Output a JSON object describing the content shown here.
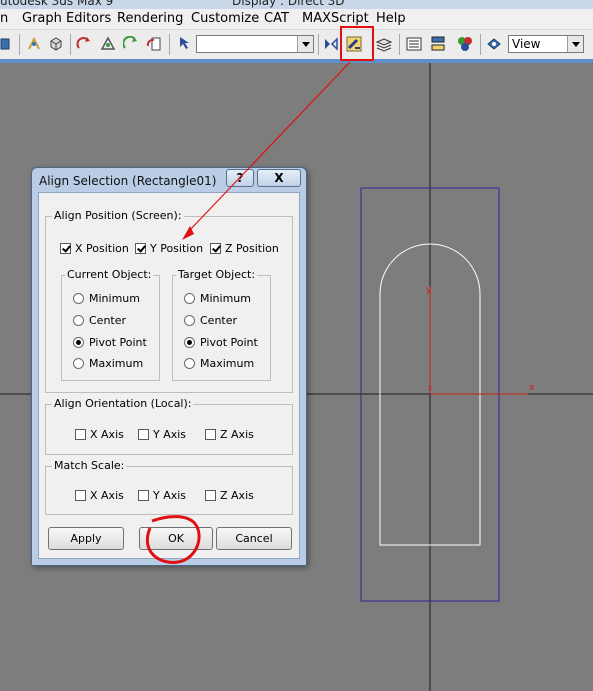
{
  "window": {
    "app_title": "utodesk 3ds Max 9",
    "display_title": "Display : Direct 3D"
  },
  "menu": {
    "items": [
      "n",
      "Graph Editors",
      "Rendering",
      "Customize",
      "CAT",
      "MAXScript",
      "Help"
    ]
  },
  "toolbar": {
    "selection_set_value": "",
    "view_dropdown_value": "View"
  },
  "dialog": {
    "title": "Align Selection (Rectangle01)",
    "help_button": "?",
    "close_button": "X",
    "align_position": {
      "legend": "Align Position (Screen):",
      "x": {
        "label": "X Position",
        "checked": true
      },
      "y": {
        "label": "Y Position",
        "checked": true
      },
      "z": {
        "label": "Z Position",
        "checked": true
      }
    },
    "current_object": {
      "legend": "Current Object:",
      "options": [
        "Minimum",
        "Center",
        "Pivot Point",
        "Maximum"
      ],
      "selected": "Pivot Point"
    },
    "target_object": {
      "legend": "Target Object:",
      "options": [
        "Minimum",
        "Center",
        "Pivot Point",
        "Maximum"
      ],
      "selected": "Pivot Point"
    },
    "align_orientation": {
      "legend": "Align Orientation (Local):",
      "x": {
        "label": "X Axis",
        "checked": false
      },
      "y": {
        "label": "Y Axis",
        "checked": false
      },
      "z": {
        "label": "Z Axis",
        "checked": false
      }
    },
    "match_scale": {
      "legend": "Match Scale:",
      "x": {
        "label": "X Axis",
        "checked": false
      },
      "y": {
        "label": "Y Axis",
        "checked": false
      },
      "z": {
        "label": "Z Axis",
        "checked": false
      }
    },
    "buttons": {
      "apply": "Apply",
      "ok": "OK",
      "cancel": "Cancel"
    }
  },
  "viewport": {
    "axis_y_label": "y",
    "axis_x_label": "x",
    "pivot_label": "z"
  },
  "colors": {
    "viewport_bg": "#7d7d7d",
    "grid_line": "#1a1a1a",
    "bounding_box": "#2b2893",
    "shape": "#ffffff",
    "axis": "#cc1f1f",
    "annotation": "#e01010"
  }
}
